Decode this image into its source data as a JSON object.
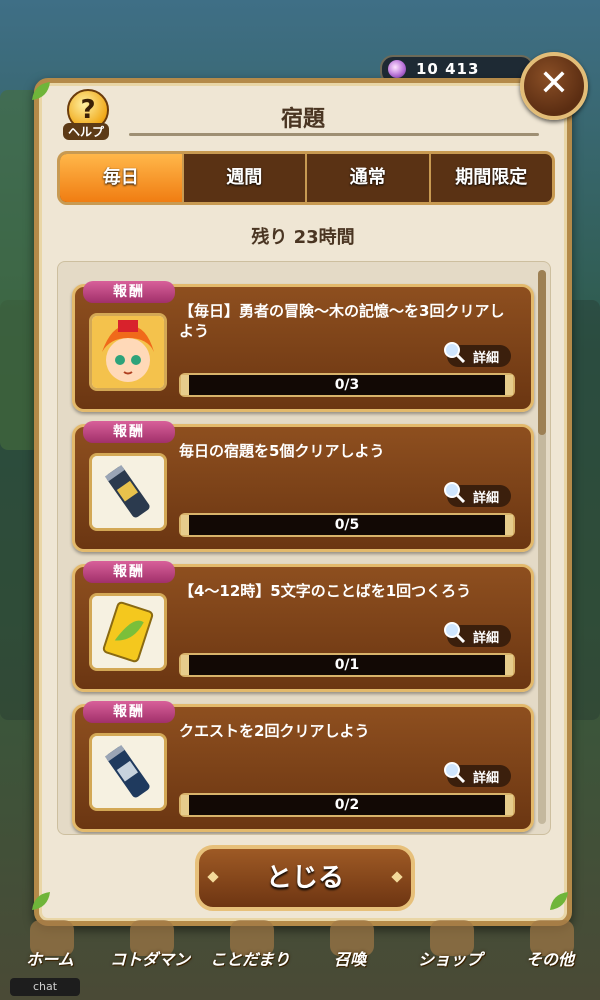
{
  "status": {
    "gem_count": "10 413"
  },
  "header": {
    "title": "宿題",
    "help_label": "ヘルプ",
    "help_symbol": "?",
    "close_symbol": "✕"
  },
  "tabs": [
    {
      "label": "毎日",
      "active": true
    },
    {
      "label": "週間",
      "active": false
    },
    {
      "label": "通常",
      "active": false
    },
    {
      "label": "期間限定",
      "active": false
    }
  ],
  "remaining": "残り 23時間",
  "missions": [
    {
      "tag": "報酬",
      "text": "【毎日】勇者の冒険～木の記憶～を3回クリアしよう",
      "detail": "詳細",
      "progress": "0/3",
      "reward_icon": "character-portrait-icon"
    },
    {
      "tag": "報酬",
      "text": "毎日の宿題を5個クリアしよう",
      "detail": "詳細",
      "progress": "0/5",
      "reward_icon": "gold-canister-icon"
    },
    {
      "tag": "報酬",
      "text": "【4～12時】5文字のことばを1回つくろう",
      "detail": "詳細",
      "progress": "0/1",
      "reward_icon": "leaf-card-icon"
    },
    {
      "tag": "報酬",
      "text": "クエストを2回クリアしよう",
      "detail": "詳細",
      "progress": "0/2",
      "reward_icon": "silver-canister-icon"
    }
  ],
  "close_button": "とじる",
  "bottom_nav": [
    "ホーム",
    "コトダマン",
    "ことだまり",
    "召喚",
    "ショップ",
    "その他"
  ],
  "chat": "chat",
  "colors": {
    "accent": "#f07d12",
    "panel": "#efe6d4",
    "card": "#7a411a",
    "tag": "#c0457f"
  }
}
